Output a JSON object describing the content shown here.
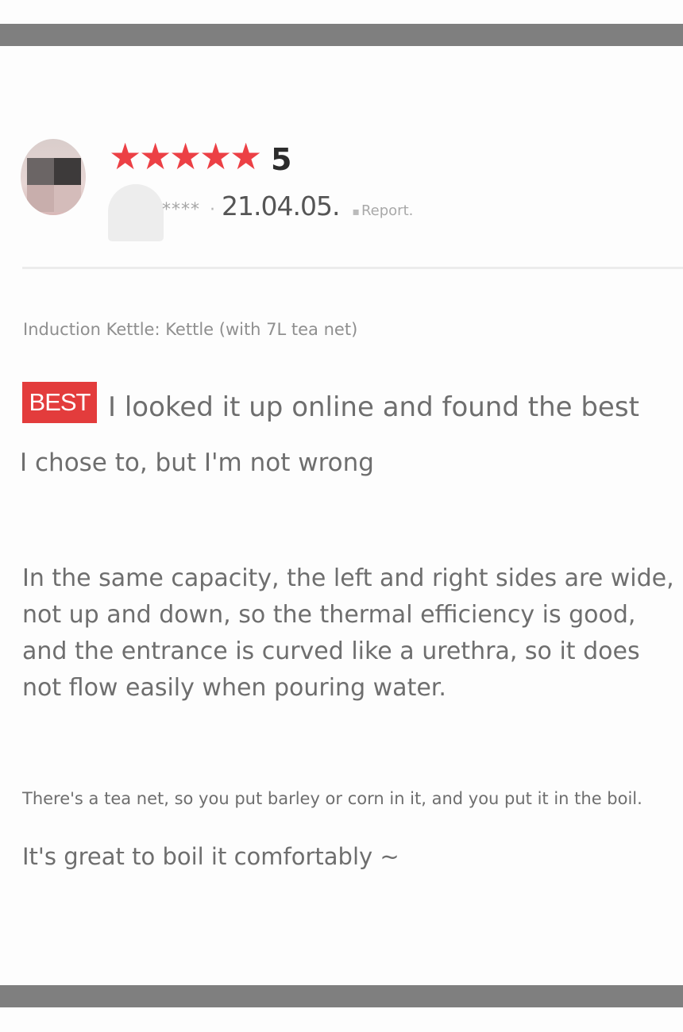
{
  "review": {
    "rating": "5",
    "stars": [
      "★",
      "★",
      "★",
      "★",
      "★"
    ],
    "user_masked": "****",
    "separator": "·",
    "date": "21.04.05.",
    "report_bullet": "▪",
    "report_label": "Report.",
    "option": "Induction Kettle: Kettle (with 7L tea net)",
    "badge": "BEST",
    "line_1": "I looked it up online and found the best",
    "line_2": "I chose to, but I'm not wrong",
    "paragraph": [
      "In the same capacity, the left and right sides are wide,",
      "not up and down, so the thermal efficiency is good,",
      "and the entrance is curved like a urethra, so it does",
      "not flow easily when pouring water."
    ],
    "small_line": "There's a tea net, so you put barley or corn in it, and you put it in the boil.",
    "last_line": "It's great to boil it comfortably ~"
  },
  "colors": {
    "star": "#ec4045",
    "badge_bg": "#e33c3c",
    "frame_bar": "#7f7f7f",
    "text": "#6e6e6e"
  },
  "icons": {
    "star": "star-icon",
    "avatar": "blurred-avatar"
  }
}
